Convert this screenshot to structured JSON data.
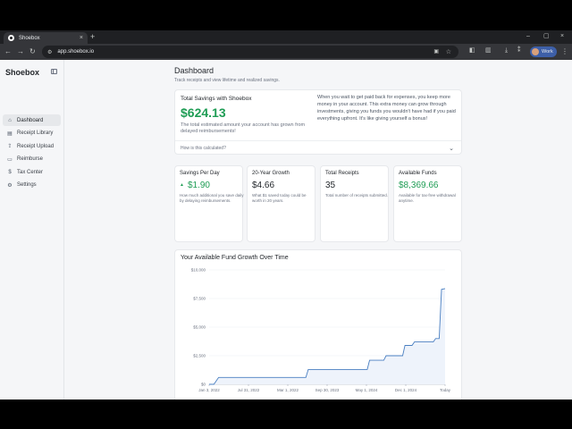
{
  "browser": {
    "tab_title": "Shoebox",
    "tab_close": "×",
    "new_tab": "+",
    "url": "app.shoebox.io",
    "profile_label": "Work",
    "window_controls": [
      "–",
      "▢",
      "×"
    ],
    "nav": {
      "back": "←",
      "forward": "→",
      "reload": "↻"
    }
  },
  "sidebar": {
    "brand": "Shoebox",
    "items": [
      {
        "label": "Dashboard",
        "icon": "home-icon",
        "glyph": "⌂",
        "active": true
      },
      {
        "label": "Receipt Library",
        "icon": "library-icon",
        "glyph": "▤",
        "active": false
      },
      {
        "label": "Receipt Upload",
        "icon": "upload-icon",
        "glyph": "⇪",
        "active": false
      },
      {
        "label": "Reimburse",
        "icon": "reimburse-icon",
        "glyph": "▭",
        "active": false
      },
      {
        "label": "Tax Center",
        "icon": "tax-icon",
        "glyph": "$",
        "active": false
      },
      {
        "label": "Settings",
        "icon": "gear-icon",
        "glyph": "⚙",
        "active": false
      }
    ]
  },
  "dashboard": {
    "title": "Dashboard",
    "subtitle": "Track receipts and view lifetime and realized savings.",
    "savings": {
      "title": "Total Savings with Shoebox",
      "value": "$624.13",
      "desc": "The total estimated amount your account has grown from delayed reimbursements!",
      "explain": "When you wait to get paid back for expenses, you keep more money in your account. This extra money can grow through investments, giving you funds you wouldn't have had if you paid everything upfront. It's like giving yourself a bonus!",
      "accordion_label": "How is this calculated?"
    },
    "stats": [
      {
        "title": "Savings Per Day",
        "value": "$1.90",
        "desc": "How much additional you save daily by delaying reimbursements.",
        "green": true,
        "arrow": "▲"
      },
      {
        "title": "20-Year Growth",
        "value": "$4.66",
        "desc": "What $1 saved today could be worth in 20 years.",
        "green": false
      },
      {
        "title": "Total Receipts",
        "value": "35",
        "desc": "Total number of receipts submitted.",
        "green": false
      },
      {
        "title": "Available Funds",
        "value": "$8,369.66",
        "desc": "Available for tax-free withdrawal anytime.",
        "green": true
      }
    ]
  },
  "chart_data": {
    "type": "area",
    "title": "Your Available Fund Growth Over Time",
    "xlabel": "",
    "ylabel": "",
    "ylim": [
      0,
      10000
    ],
    "yticks": [
      "$0",
      "$2,500",
      "$5,000",
      "$7,500",
      "$10,000"
    ],
    "ytick_values": [
      0,
      2500,
      5000,
      7500,
      10000
    ],
    "xticks": [
      "Jan 3, 2022",
      "Jul 31, 2022",
      "Mar 1, 2022",
      "Sep 30, 2023",
      "May 1, 2024",
      "Dec 1, 2024",
      "Today"
    ],
    "grid": true,
    "color": "#4a7fc1",
    "fill": "#eef3fb",
    "series": [
      {
        "points": [
          [
            0,
            0
          ],
          [
            0.02,
            0
          ],
          [
            0.04,
            600
          ],
          [
            0.41,
            600
          ],
          [
            0.42,
            1300
          ],
          [
            0.67,
            1300
          ],
          [
            0.68,
            2100
          ],
          [
            0.74,
            2100
          ],
          [
            0.75,
            2500
          ],
          [
            0.82,
            2500
          ],
          [
            0.83,
            3400
          ],
          [
            0.86,
            3400
          ],
          [
            0.87,
            3700
          ],
          [
            0.95,
            3700
          ],
          [
            0.96,
            4000
          ],
          [
            0.975,
            4000
          ],
          [
            0.985,
            8300
          ],
          [
            1.0,
            8370
          ]
        ]
      }
    ]
  }
}
